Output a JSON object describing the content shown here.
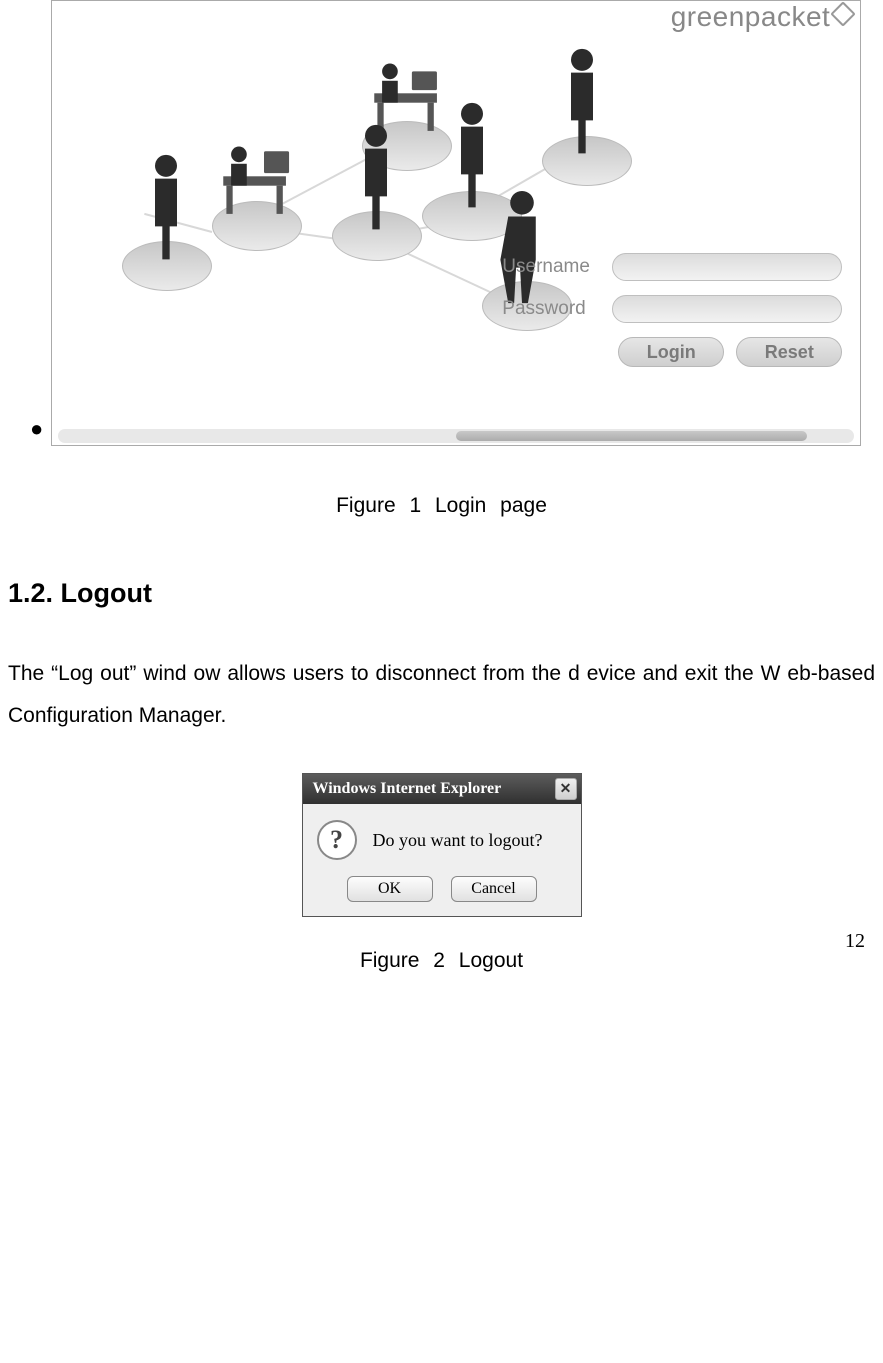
{
  "login_screenshot": {
    "brand": "greenpacket",
    "form": {
      "username_label": "Username",
      "password_label": "Password",
      "login_button": "Login",
      "reset_button": "Reset"
    }
  },
  "figure1_caption": "Figure 1    Login page",
  "section_heading": "1.2. Logout",
  "section_body": "The “Log out” wind ow  allows  users to   disconnect from the d  evice and  exit the W  eb-based Configuration Manager.",
  "logout_dialog": {
    "title": "Windows Internet Explorer",
    "close": "✕",
    "question_glyph": "?",
    "message": "Do you want to logout?",
    "ok": "OK",
    "cancel": "Cancel"
  },
  "figure2_caption": "Figure 2    Logout",
  "page_number": "12"
}
